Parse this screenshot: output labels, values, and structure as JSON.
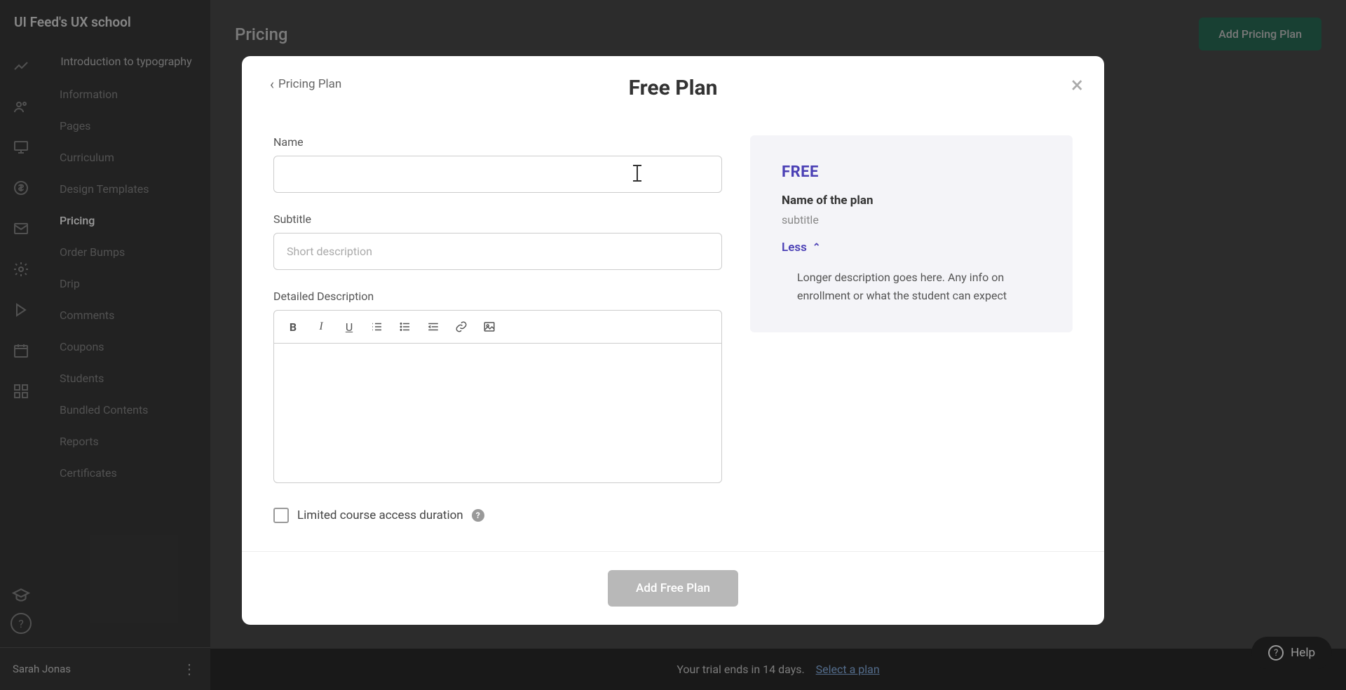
{
  "school_name": "UI Feed's UX school",
  "course_name": "Introduction to typography",
  "sidebar": {
    "items": [
      {
        "label": "Information"
      },
      {
        "label": "Pages"
      },
      {
        "label": "Curriculum"
      },
      {
        "label": "Design Templates"
      },
      {
        "label": "Pricing",
        "active": true
      },
      {
        "label": "Order Bumps"
      },
      {
        "label": "Drip"
      },
      {
        "label": "Comments"
      },
      {
        "label": "Coupons"
      },
      {
        "label": "Students"
      },
      {
        "label": "Bundled Contents"
      },
      {
        "label": "Reports"
      },
      {
        "label": "Certificates"
      }
    ]
  },
  "user_name": "Sarah Jonas",
  "page_title": "Pricing",
  "add_plan_button": "Add Pricing Plan",
  "trial_text": "Your trial ends in 14 days.",
  "trial_link": "Select a plan",
  "help_label": "Help",
  "modal": {
    "breadcrumb": "Pricing Plan",
    "title": "Free Plan",
    "name_label": "Name",
    "name_value": "",
    "subtitle_label": "Subtitle",
    "subtitle_placeholder": "Short description",
    "detailed_label": "Detailed Description",
    "checkbox_label": "Limited course access duration",
    "submit_label": "Add Free Plan"
  },
  "preview": {
    "price_label": "FREE",
    "name_text": "Name of the plan",
    "subtitle_text": "subtitle",
    "toggle_label": "Less",
    "description_text": "Longer description goes here. Any info on enrollment or what the student can expect"
  }
}
